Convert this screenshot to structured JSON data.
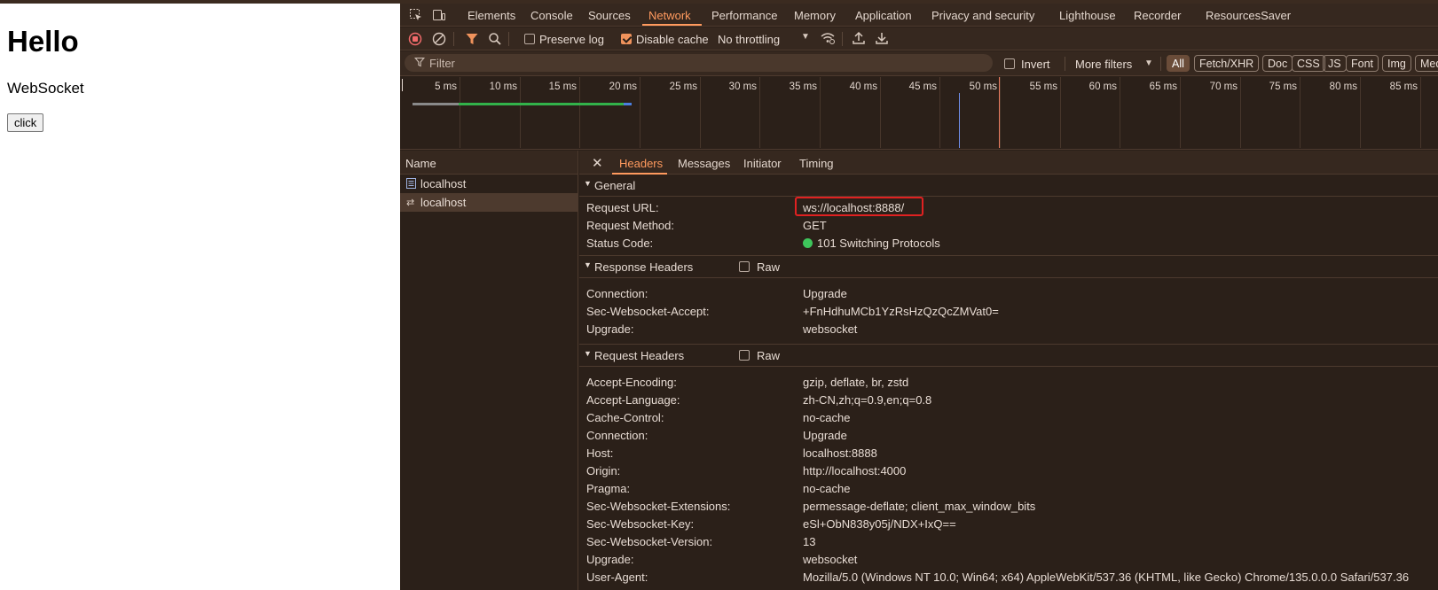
{
  "page": {
    "heading": "Hello",
    "subtitle": "WebSocket",
    "button_label": "click"
  },
  "devtools": {
    "tabs": [
      "Elements",
      "Console",
      "Sources",
      "Network",
      "Performance",
      "Memory",
      "Application",
      "Privacy and security",
      "Lighthouse",
      "Recorder",
      "ResourcesSaver"
    ],
    "active_tab": "Network",
    "toolbar": {
      "preserve_log_label": "Preserve log",
      "preserve_log_checked": false,
      "disable_cache_label": "Disable cache",
      "disable_cache_checked": true,
      "throttling_value": "No throttling"
    },
    "filterbar": {
      "filter_placeholder": "Filter",
      "invert_label": "Invert",
      "more_filters_label": "More filters",
      "type_filters": [
        "All",
        "Fetch/XHR",
        "Doc",
        "CSS",
        "JS",
        "Font",
        "Img",
        "Med"
      ],
      "active_type_filter": "All"
    },
    "timeline": {
      "tick_labels": [
        "5 ms",
        "10 ms",
        "15 ms",
        "20 ms",
        "25 ms",
        "30 ms",
        "35 ms",
        "40 ms",
        "45 ms",
        "50 ms",
        "55 ms",
        "60 ms",
        "65 ms",
        "70 ms",
        "75 ms",
        "80 ms",
        "85 ms"
      ]
    },
    "requests": {
      "column_header": "Name",
      "items": [
        {
          "name": "localhost",
          "icon": "document-icon",
          "selected": false
        },
        {
          "name": "localhost",
          "icon": "websocket-icon",
          "selected": true
        }
      ]
    },
    "detail": {
      "tabs": [
        "Headers",
        "Messages",
        "Initiator",
        "Timing"
      ],
      "active_tab": "Headers",
      "general": {
        "title": "General",
        "rows": [
          {
            "key": "Request URL:",
            "value": "ws://localhost:8888/"
          },
          {
            "key": "Request Method:",
            "value": "GET"
          },
          {
            "key": "Status Code:",
            "value": "101 Switching Protocols"
          }
        ]
      },
      "response_headers": {
        "title": "Response Headers",
        "raw_label": "Raw",
        "rows": [
          {
            "key": "Connection:",
            "value": "Upgrade"
          },
          {
            "key": "Sec-Websocket-Accept:",
            "value": "+FnHdhuMCb1YzRsHzQzQcZMVat0="
          },
          {
            "key": "Upgrade:",
            "value": "websocket"
          }
        ]
      },
      "request_headers": {
        "title": "Request Headers",
        "raw_label": "Raw",
        "rows": [
          {
            "key": "Accept-Encoding:",
            "value": "gzip, deflate, br, zstd"
          },
          {
            "key": "Accept-Language:",
            "value": "zh-CN,zh;q=0.9,en;q=0.8"
          },
          {
            "key": "Cache-Control:",
            "value": "no-cache"
          },
          {
            "key": "Connection:",
            "value": "Upgrade"
          },
          {
            "key": "Host:",
            "value": "localhost:8888"
          },
          {
            "key": "Origin:",
            "value": "http://localhost:4000"
          },
          {
            "key": "Pragma:",
            "value": "no-cache"
          },
          {
            "key": "Sec-Websocket-Extensions:",
            "value": "permessage-deflate; client_max_window_bits"
          },
          {
            "key": "Sec-Websocket-Key:",
            "value": "eSl+ObN838y05j/NDX+IxQ=="
          },
          {
            "key": "Sec-Websocket-Version:",
            "value": "13"
          },
          {
            "key": "Upgrade:",
            "value": "websocket"
          },
          {
            "key": "User-Agent:",
            "value": "Mozilla/5.0 (Windows NT 10.0; Win64; x64) AppleWebKit/537.36 (KHTML, like Gecko) Chrome/135.0.0.0 Safari/537.36"
          }
        ]
      }
    },
    "colors": {
      "accent": "#ff9a5e",
      "status_ok": "#3ec55b",
      "highlight_box": "#e02121"
    }
  }
}
